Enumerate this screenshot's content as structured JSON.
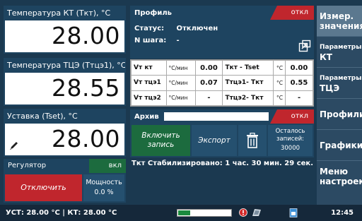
{
  "panels": {
    "temp_kt": {
      "title": "Температура КТ (Tкт), °C",
      "value": "28.00"
    },
    "temp_tce": {
      "title": "Температура ТЦЭ (Tтцэ1), °C",
      "value": "28.55"
    },
    "setpoint": {
      "title": "Уставка (Tset), °C",
      "value": "28.00"
    }
  },
  "regulator": {
    "title": "Регулятор",
    "status": "вкл",
    "off_button": "Отключить",
    "power_label": "Мощность",
    "power_value": "0.0 %"
  },
  "profile": {
    "title": "Профиль",
    "status": "откл",
    "status_label": "Статус:",
    "status_value": "Отключен",
    "step_label": "N шага:",
    "step_value": "-"
  },
  "table": {
    "rows": [
      {
        "n1": "Vт кт",
        "u1": "°C/мин",
        "v1": "0.00",
        "n2": "Tкт - Tset",
        "u2": "°C",
        "v2": "0.00"
      },
      {
        "n1": "Vт тцэ1",
        "u1": "°C/мин",
        "v1": "0.07",
        "n2": "Tтцэ1- Tкт",
        "u2": "°C",
        "v2": "0.55"
      },
      {
        "n1": "Vт тцэ2",
        "u1": "°C/мин",
        "v1": "-",
        "n2": "Tтцэ2- Tкт",
        "u2": "°C",
        "v2": "-"
      }
    ]
  },
  "archive": {
    "title": "Архив",
    "status": "откл",
    "enable_button": "Включить запись",
    "export_button": "Экспорт",
    "remaining_label": "Осталось записей:",
    "remaining_value": "30000"
  },
  "stabilized_text": "Tкт  Стабилизировано: 1 час. 30 мин. 29 сек.",
  "menu": {
    "items": [
      {
        "label": "Измер. значения"
      },
      {
        "label_small": "Параметры",
        "label_big": "КТ"
      },
      {
        "label_small": "Параметры",
        "label_big": "ТЦЭ"
      },
      {
        "label": "Профили"
      },
      {
        "label": "Графики"
      },
      {
        "label": "Меню настроек"
      }
    ]
  },
  "statusbar": {
    "left": "УСТ: 28.00 °C | КТ: 28.00 °C",
    "progress": 0.23,
    "clock": "12:45"
  },
  "colors": {
    "accent_green": "#1c6b3e",
    "accent_red": "#c0262d",
    "panel": "#1e4460"
  }
}
